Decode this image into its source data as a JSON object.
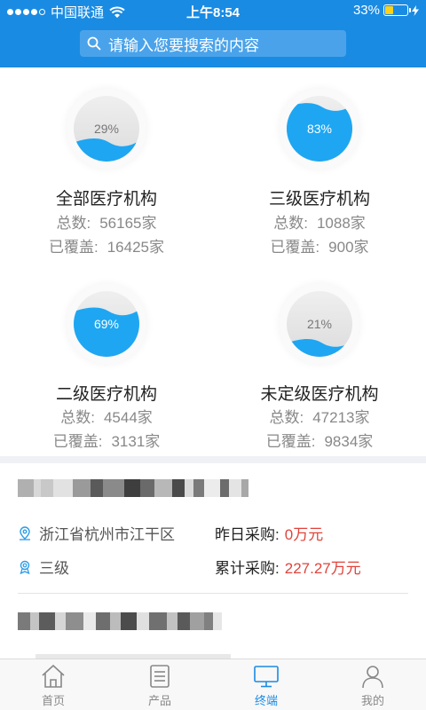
{
  "status": {
    "carrier": "中国联通",
    "time": "上午8:54",
    "battery": "33%",
    "battery_level": 0.33
  },
  "search": {
    "placeholder": "请输入您要搜索的内容"
  },
  "stats": [
    {
      "pct_label": "29%",
      "fraction": 0.29,
      "title": "全部医疗机构",
      "total_label": "总数:",
      "total": "56165家",
      "covered_label": "已覆盖:",
      "covered": "16425家"
    },
    {
      "pct_label": "83%",
      "fraction": 0.83,
      "title": "三级医疗机构",
      "total_label": "总数:",
      "total": "1088家",
      "covered_label": "已覆盖:",
      "covered": "900家"
    },
    {
      "pct_label": "69%",
      "fraction": 0.69,
      "title": "二级医疗机构",
      "total_label": "总数:",
      "total": "4544家",
      "covered_label": "已覆盖:",
      "covered": "3131家"
    },
    {
      "pct_label": "21%",
      "fraction": 0.21,
      "title": "未定级医疗机构",
      "total_label": "总数:",
      "total": "47213家",
      "covered_label": "已覆盖:",
      "covered": "9834家"
    }
  ],
  "list_item": {
    "location": "浙江省杭州市江干区",
    "level": "三级",
    "yesterday_label": "昨日采购:",
    "yesterday_value": "0万元",
    "total_label": "累计采购:",
    "total_value": "227.27万元"
  },
  "tabs": [
    {
      "label": "首页",
      "icon": "home-icon",
      "active": false
    },
    {
      "label": "产品",
      "icon": "document-icon",
      "active": false
    },
    {
      "label": "终端",
      "icon": "monitor-icon",
      "active": true
    },
    {
      "label": "我的",
      "icon": "user-icon",
      "active": false
    }
  ],
  "colors": {
    "brand": "#1a8be3",
    "gauge_fill": "#1ea6f2",
    "accent_red": "#e0433b"
  }
}
